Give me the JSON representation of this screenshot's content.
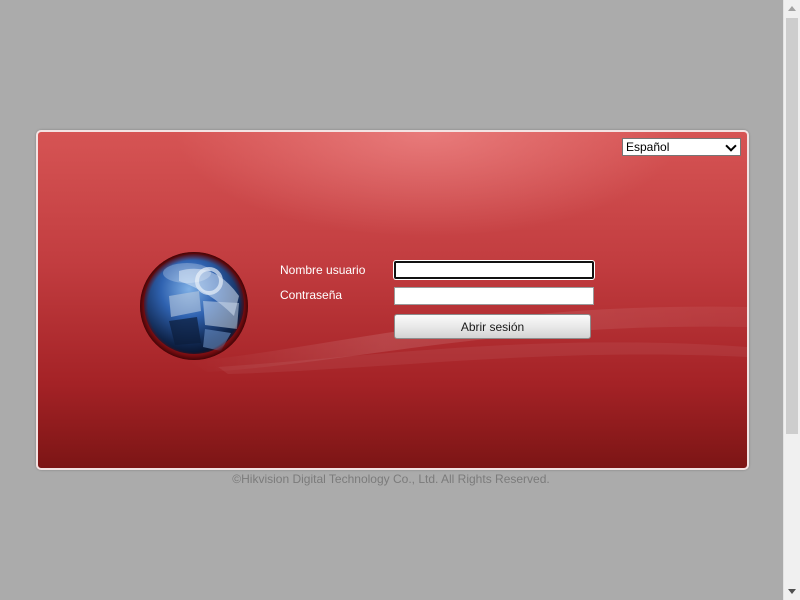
{
  "language_select": {
    "selected": "Español"
  },
  "login_form": {
    "username_label": "Nombre usuario",
    "username_value": "",
    "password_label": "Contraseña",
    "password_value": "",
    "submit_label": "Abrir sesión"
  },
  "footer": {
    "copyright": "©Hikvision Digital Technology Co., Ltd. All Rights Reserved."
  },
  "colors": {
    "page_background": "#ababab",
    "panel_red": "#c13c3f",
    "panel_dark_red": "#7c1515"
  },
  "icons": {
    "logo": "globe-logo-icon",
    "dropdown": "chevron-down-icon"
  }
}
